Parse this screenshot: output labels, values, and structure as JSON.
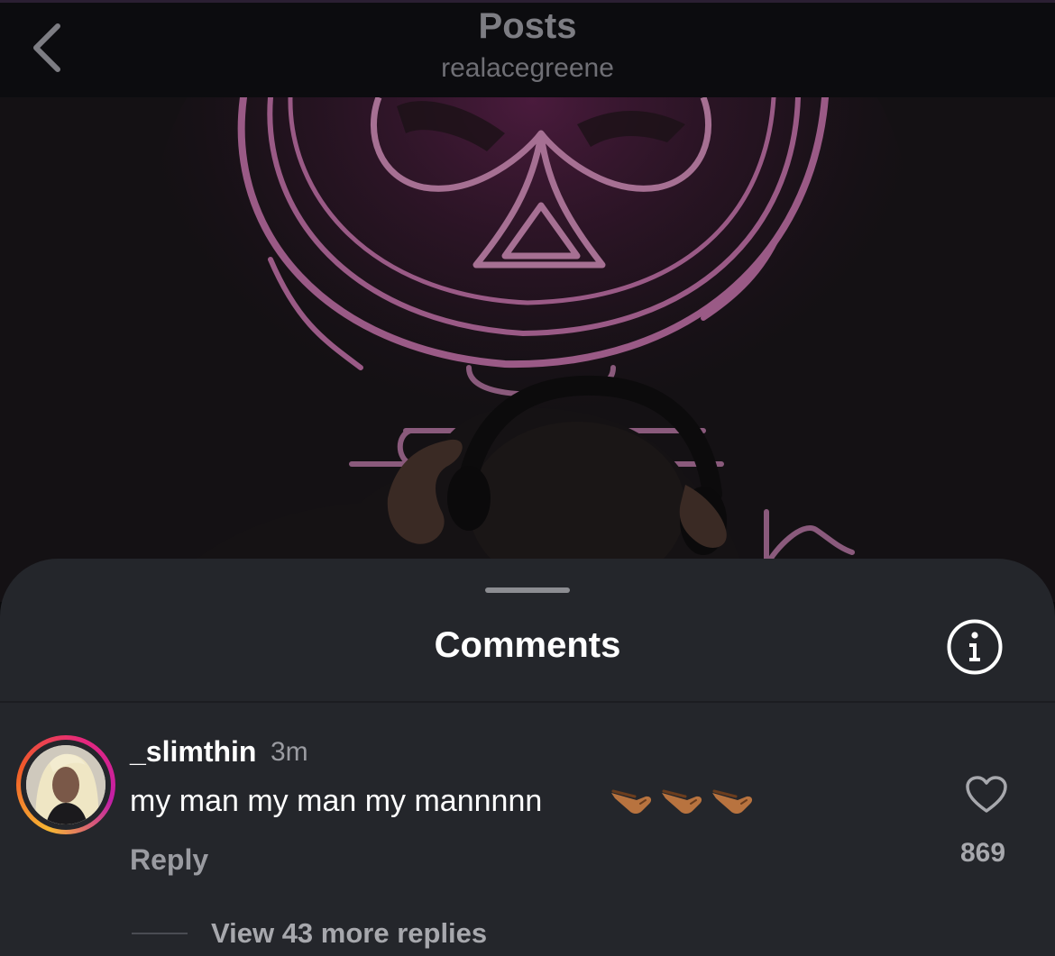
{
  "nav": {
    "title": "Posts",
    "subtitle": "realacegreene"
  },
  "comments_sheet": {
    "title": "Comments"
  },
  "comment": {
    "username": "_slimthin",
    "time": "3m",
    "text": "my man my man my mannnnn",
    "emojis": [
      "pinching-hand-emoji",
      "pinching-hand-emoji",
      "pinching-hand-emoji"
    ],
    "reply_label": "Reply",
    "like_count": "869",
    "view_replies_label": "View 43 more replies"
  },
  "icons": {
    "back": "chevron-left-icon",
    "info": "info-icon",
    "like": "heart-icon"
  },
  "colors": {
    "neon": "#c2418e",
    "sheet_bg": "#24262b",
    "avatar_ring_start": "#f7b733",
    "avatar_ring_end": "#c21fa7"
  }
}
